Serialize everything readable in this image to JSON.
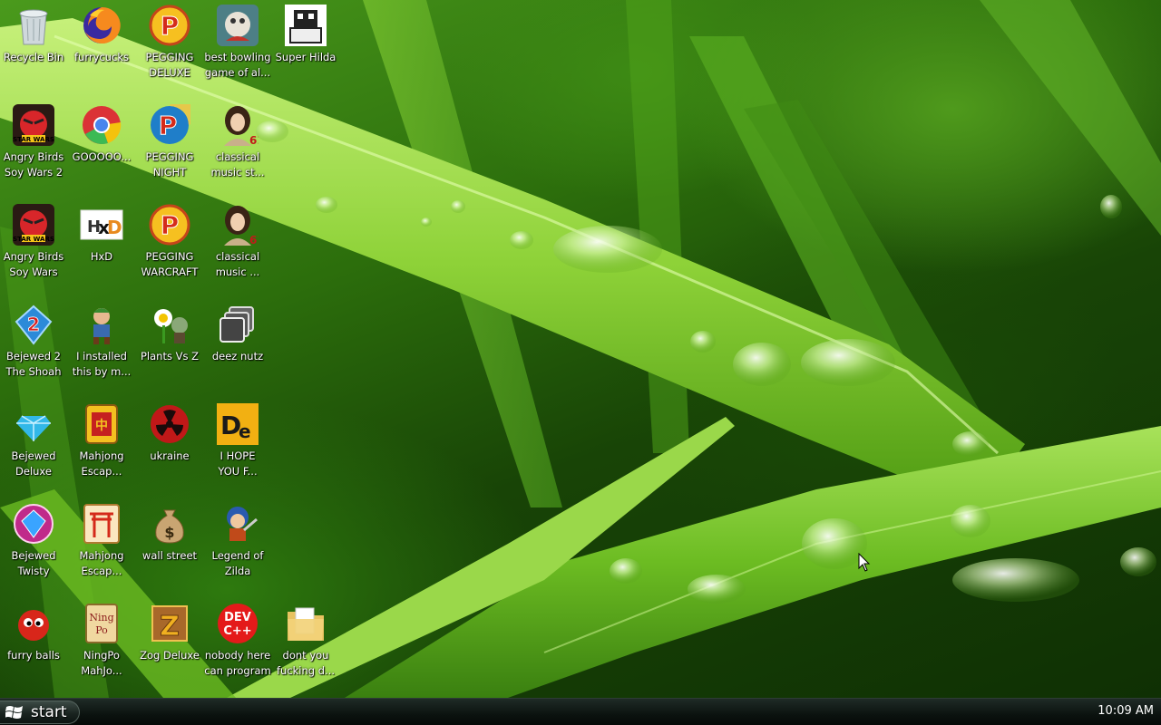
{
  "desktop": {
    "icons": [
      {
        "label": "Recycle Bin",
        "icon": "recycle-bin-icon"
      },
      {
        "label": "furrycucks",
        "icon": "firefox-icon"
      },
      {
        "label": "PEGGING\nDELUXE",
        "icon": "pegging-p-icon"
      },
      {
        "label": "best bowling\ngame of al...",
        "icon": "bowling-game-icon"
      },
      {
        "label": "Super Hilda",
        "icon": "super-hilda-icon"
      },
      {
        "label": "Angry Birds\nSoy Wars 2",
        "icon": "angry-birds-star-wars-icon"
      },
      {
        "label": "GOOOOO...",
        "icon": "chrome-icon"
      },
      {
        "label": "PEGGING\nNIGHT",
        "icon": "pegging-night-icon"
      },
      {
        "label": "classical\nmusic st...",
        "icon": "classical-music-portrait-icon"
      },
      {
        "label": "Angry Birds\nSoy Wars",
        "icon": "angry-birds-star-wars-icon"
      },
      {
        "label": "HxD",
        "icon": "hxd-icon"
      },
      {
        "label": "PEGGING\nWARCRAFT",
        "icon": "pegging-p-icon"
      },
      {
        "label": "classical\nmusic ...",
        "icon": "classical-music-portrait-icon"
      },
      {
        "label": "Bejewed 2\nThe Shoah",
        "icon": "bejeweled-2-icon"
      },
      {
        "label": "I installed\nthis by m...",
        "icon": "game-character-icon"
      },
      {
        "label": "Plants Vs Z",
        "icon": "plants-vs-zombies-icon"
      },
      {
        "label": "deez nutz",
        "icon": "windows-stack-icon"
      },
      {
        "label": "Bejewed\nDeluxe",
        "icon": "blue-gem-icon"
      },
      {
        "label": "Mahjong\nEscap...",
        "icon": "mahjong-tile-icon"
      },
      {
        "label": "ukraine",
        "icon": "radiation-icon"
      },
      {
        "label": "I HOPE\nYOU F...",
        "icon": "de-logo-icon"
      },
      {
        "label": "Bejewed\nTwisty",
        "icon": "bejeweled-twist-icon"
      },
      {
        "label": "Mahjong\nEscap...",
        "icon": "mahjong-gate-icon"
      },
      {
        "label": "wall street",
        "icon": "money-bag-icon"
      },
      {
        "label": "Legend of\nZilda",
        "icon": "legend-character-icon"
      },
      {
        "label": "furry balls",
        "icon": "red-furball-icon"
      },
      {
        "label": "NingPo\nMahJo...",
        "icon": "ningpo-tile-icon"
      },
      {
        "label": "Zog Deluxe",
        "icon": "zuma-z-icon"
      },
      {
        "label": "nobody here\ncan program",
        "icon": "dev-cpp-icon"
      },
      {
        "label": "dont you\nfucking d...",
        "icon": "folder-icon"
      }
    ]
  },
  "taskbar": {
    "start_label": "start",
    "clock": "10:09 AM"
  },
  "colors": {
    "label_text": "#ffffff",
    "taskbar": "#0b120f"
  }
}
